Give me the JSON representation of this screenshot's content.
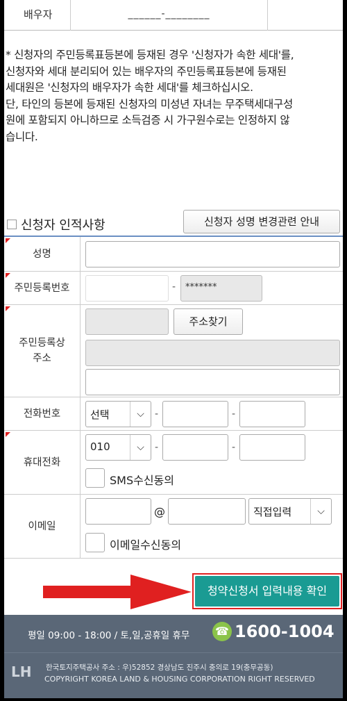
{
  "top_row": {
    "label": "배우자",
    "value": "______-________"
  },
  "notice": [
    "* 신청자의 주민등록표등본에 등재된 경우 '신청자가 속한 세대'를,",
    "신청자와 세대 분리되어 있는 배우자의 주민등록표등본에 등재된",
    "세대원은 '신청자의 배우자가 속한 세대'를 체크하십시오.",
    "단, 타인의 등본에 등재된 신청자의 미성년 자녀는 무주택세대구성",
    "원에 포함되지 아니하므로 소득검증 시 가구원수로는 인정하지 않",
    "습니다."
  ],
  "section": {
    "title": "신청자 인적사항",
    "guide_button": "신청자 성명 변경관련 안내"
  },
  "form": {
    "name_label": "성명",
    "rrn_label": "주민등록번호",
    "rrn_back": "*******",
    "rrn_dash": "-",
    "address_label_1": "주민등록상",
    "address_label_2": "주소",
    "address_search": "주소찾기",
    "phone_label": "전화번호",
    "phone_select": "선택",
    "mobile_label": "휴대전화",
    "mobile_select": "010",
    "sms_consent": "SMS수신동의",
    "email_label": "이메일",
    "email_at": "@",
    "email_domain_select": "직접입력",
    "email_consent": "이메일수신동의"
  },
  "submit_label": "청약신청서 입력내용 확인",
  "footer": {
    "hours": "평일 09:00 - 18:00 / 토,일,공휴일 휴무",
    "phone": "1600-1004",
    "logo": "LH",
    "address": "한국토지주택공사    주소 : 우)52852    경상남도 진주시 충의로 19(충무공동)",
    "copyright": "COPYRIGHT KOREA LAND & HOUSING CORPORATION RIGHT RESERVED"
  },
  "colors": {
    "submit": "#1a9b93",
    "highlight": "#e02020",
    "footer_bg": "#5a6777",
    "phone_icon": "#8bc34a"
  },
  "icons": {
    "select_arrow": "chevron-down-icon",
    "phone": "phone-icon"
  }
}
